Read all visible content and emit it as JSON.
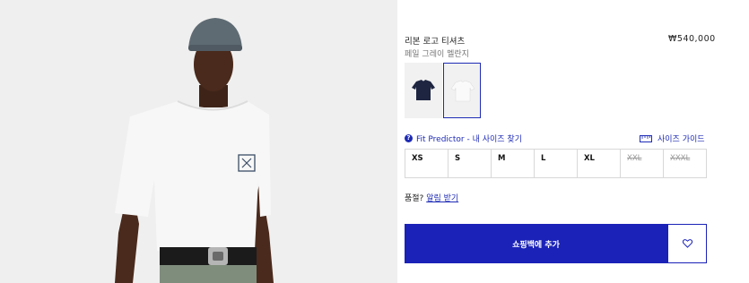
{
  "product": {
    "title": "리본 로고 티셔츠",
    "price": "₩540,000",
    "color_name": "페일 그레이 멜란지",
    "image_alt": "model-wearing-tshirt"
  },
  "swatches": [
    {
      "name": "navy",
      "color": "#1d2540",
      "selected": false
    },
    {
      "name": "pale-grey",
      "color": "#f4f4f4",
      "selected": true
    }
  ],
  "fit_predictor": {
    "label": "Fit Predictor - 내 사이즈 찾기",
    "icon": "question-icon"
  },
  "size_guide": {
    "label": "사이즈 가이드",
    "icon": "ruler-icon"
  },
  "sizes": [
    {
      "label": "XS",
      "available": true
    },
    {
      "label": "S",
      "available": true
    },
    {
      "label": "M",
      "available": true
    },
    {
      "label": "L",
      "available": true
    },
    {
      "label": "XL",
      "available": true
    },
    {
      "label": "XXL",
      "available": false
    },
    {
      "label": "XXXL",
      "available": false
    }
  ],
  "stock": {
    "prefix": "품절?",
    "link": "알림 받기"
  },
  "add_to_cart": "쇼핑백에 추가",
  "wishlist": {
    "icon": "heart-icon"
  },
  "colors": {
    "accent": "#1a22b8"
  }
}
